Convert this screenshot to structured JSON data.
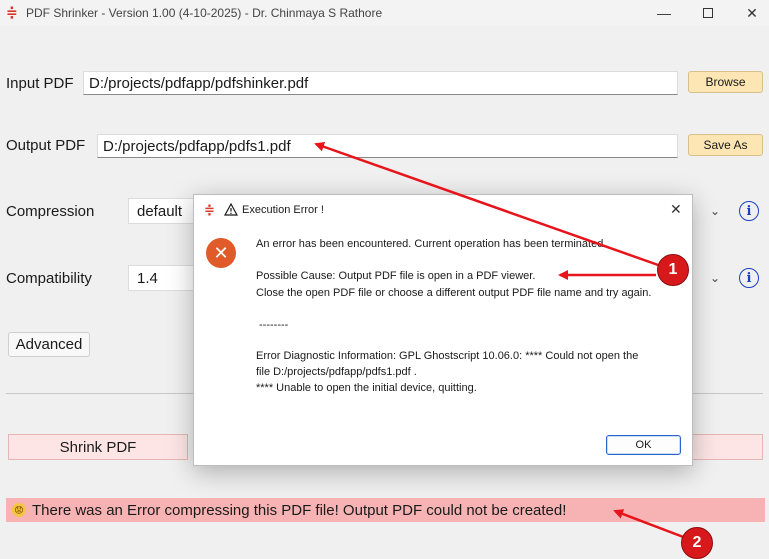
{
  "window": {
    "title": "PDF Shrinker - Version 1.00 (4-10-2025)  - Dr. Chinmaya S Rathore",
    "app_icon": "≑",
    "minimize_glyph": "—",
    "close_glyph": "✕"
  },
  "form": {
    "input_label": "Input PDF",
    "input_value": "D:/projects/pdfapp/pdfshinker.pdf",
    "browse_label": "Browse",
    "output_label": "Output PDF",
    "output_value": "D:/projects/pdfapp/pdfs1.pdf",
    "save_as_label": "Save As",
    "compression_label": "Compression",
    "compression_value": "default",
    "compatibility_label": "Compatibility",
    "compatibility_value": "1.4",
    "info_glyph": "i",
    "chevron_glyph": "⌄",
    "advanced_label": "Advanced",
    "shrink_label": "Shrink PDF"
  },
  "status": {
    "emoji": "😟",
    "text": "There was an Error compressing this PDF file! Output PDF could not be created!"
  },
  "dialog": {
    "title": "Execution Error !",
    "error_glyph": "✕",
    "close_glyph": "✕",
    "line1": "An error has been encountered. Current operation has been terminated.",
    "line2": "Possible Cause: Output PDF file is open in a PDF viewer.",
    "line3": "Close the open PDF file or choose a different output PDF file name and try again.",
    "line4": "--------",
    "line5": "Error Diagnostic Information: GPL Ghostscript 10.06.0: **** Could not open the",
    "line6": "file D:/projects/pdfapp/pdfs1.pdf .",
    "line7": "**** Unable to open the initial device, quitting.",
    "ok_label": "OK"
  },
  "annotations": {
    "badge1": "1",
    "badge2": "2",
    "color": "#e8141c"
  }
}
